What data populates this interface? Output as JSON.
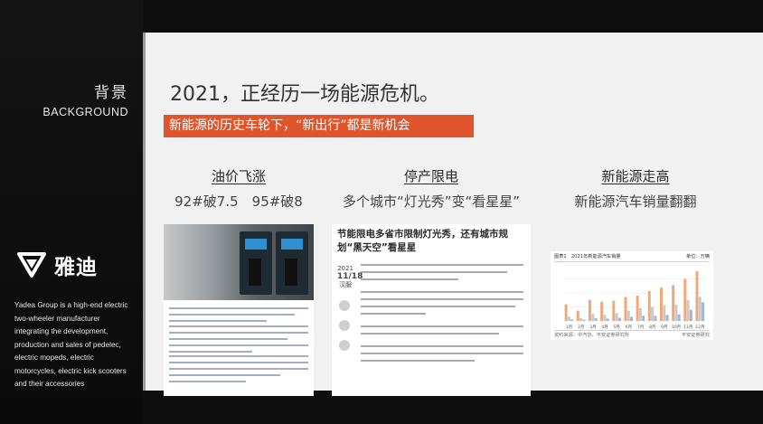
{
  "sidebar": {
    "section_cn": "背景",
    "section_en": "BACKGROUND",
    "logo_text": "雅迪",
    "description": "Yadea Group is a high-end electric two-wheeler manufacturer integrating the development, production and sales of pedelec, electric mopeds, electric motorcycles, electric kick scooters and their accessories"
  },
  "slide": {
    "headline": "2021，正经历一场能源危机。",
    "banner": "新能源的历史车轮下，“新出行”都是新机会",
    "columns": [
      {
        "title": "油价飞涨",
        "subtitle": "92#破7.5　95#破8"
      },
      {
        "title": "停产限电",
        "subtitle": "多个城市“灯光秀”变“看星星”"
      },
      {
        "title": "新能源走高",
        "subtitle": "新能源汽车销量翻翻"
      }
    ],
    "article": {
      "headline": "节能限电多省市限制灯光秀，还有城市规划“黑天空”看星星",
      "date_year": "2021",
      "date_day": "11/18",
      "date_label": "汉服"
    },
    "chart_card": {
      "header_left": "图表1　2021年新能源汽车销量",
      "header_right": "单位：万辆",
      "footer_left": "资料来源：中汽协，平安证券研究所",
      "footer_right": "平安证券研究"
    }
  },
  "chart_data": {
    "type": "bar",
    "categories": [
      "1月",
      "2月",
      "3月",
      "4月",
      "5月",
      "6月",
      "7月",
      "8月",
      "9月",
      "10月",
      "11月",
      "12月"
    ],
    "series": [
      {
        "name": "series-a",
        "values": [
          17.9,
          11.0,
          22.6,
          20.6,
          21.7,
          25.6,
          27.1,
          32.1,
          35.7,
          38.3,
          45.0,
          53.1
        ]
      },
      {
        "name": "series-b",
        "values": [
          4.5,
          2.9,
          7.8,
          6.6,
          8.2,
          11.0,
          13.7,
          14.9,
          17.0,
          17.5,
          22.5,
          25.9
        ]
      },
      {
        "name": "series-c",
        "values": [
          1.6,
          1.3,
          3.0,
          2.5,
          3.5,
          4.5,
          5.4,
          5.5,
          6.5,
          7.0,
          12.0,
          20.0
        ]
      }
    ],
    "ylim": [
      0,
      60
    ],
    "colors": [
      "#f2a778",
      "#c9c9c9",
      "#9fb6d6"
    ]
  }
}
